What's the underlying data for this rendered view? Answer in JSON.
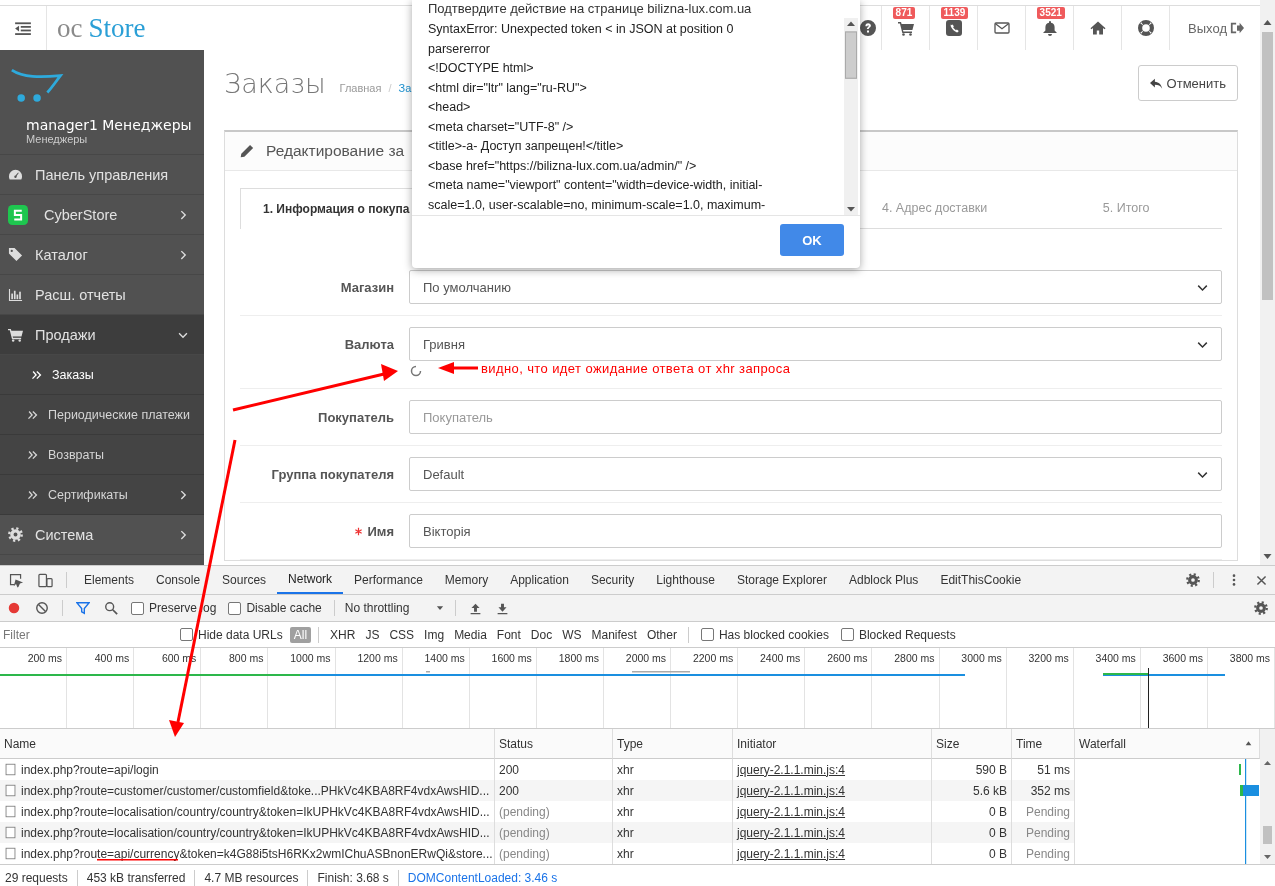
{
  "header": {
    "logo_prefix": "oc",
    "logo_name": "Store",
    "icons": [
      {
        "kind": "help"
      },
      {
        "kind": "cart",
        "badge": "871"
      },
      {
        "kind": "phone",
        "badge": "1139"
      },
      {
        "kind": "mail"
      },
      {
        "kind": "bell",
        "badge": "3521"
      },
      {
        "kind": "home"
      },
      {
        "kind": "lifebuoy"
      }
    ],
    "logout": "Выход"
  },
  "sidebar": {
    "user": "manager1 Менеджеры",
    "group": "Менеджеры",
    "items": [
      {
        "kind": "dashboard",
        "label": "Панель управления"
      },
      {
        "kind": "app",
        "label": "CyberStore",
        "expanded": false
      },
      {
        "kind": "tags",
        "label": "Каталог",
        "expanded": false
      },
      {
        "kind": "bars",
        "label": "Расш. отчеты"
      },
      {
        "kind": "cart",
        "label": "Продажи",
        "expanded": true,
        "children": [
          {
            "label": "Заказы",
            "selected": true
          },
          {
            "label": "Периодические платежи",
            "selected": false
          },
          {
            "label": "Возвраты",
            "selected": false
          },
          {
            "label": "Сертификаты",
            "selected": false,
            "expanded": false
          }
        ]
      },
      {
        "kind": "gear",
        "label": "Система",
        "expanded": false
      }
    ]
  },
  "page": {
    "title": "Заказы",
    "breadcrumb": {
      "items": [
        "Главная",
        "За"
      ],
      "separator": "/"
    },
    "cancel_button": "Отменить",
    "panel_title": "Редактирование за",
    "tabs": [
      {
        "label": "1. Информация о покупа",
        "selected": true
      },
      {
        "label": "4. Адрес доставки",
        "selected": false
      },
      {
        "label": "5. Итого",
        "selected": false
      }
    ],
    "form": [
      {
        "kind": "select",
        "label": "Магазин",
        "value": "По умолчанию"
      },
      {
        "kind": "select",
        "label": "Валюта",
        "value": "Гривня",
        "loading": true
      },
      {
        "kind": "input",
        "label": "Покупатель",
        "placeholder": "Покупатель"
      },
      {
        "kind": "select",
        "label": "Группа покупателя",
        "value": "Default"
      },
      {
        "kind": "input",
        "label": "Имя",
        "required": true,
        "value": "Вiкторiя"
      }
    ]
  },
  "dialog": {
    "title": "Подтвердите действие на странице bilizna-lux.com.ua",
    "lines": [
      "SyntaxError: Unexpected token < in JSON at position 0",
      "parsererror",
      "<!DOCTYPE html>",
      "<html dir=\"ltr\" lang=\"ru-RU\">",
      "<head>",
      "<meta charset=\"UTF-8\" />",
      "<title>-а- Доступ запрещен!</title>",
      "<base href=\"https://bilizna-lux.com.ua/admin/\" />",
      "<meta name=\"viewport\" content=\"width=device-width, initial-",
      "scale=1.0, user-scalable=no, minimum-scale=1.0, maximum-"
    ],
    "ok_button": "OK"
  },
  "annotation": {
    "note": "видно, что идет ожидание ответа от xhr запроса"
  },
  "devtools": {
    "tabs": [
      {
        "label": "Elements",
        "selected": false
      },
      {
        "label": "Console",
        "selected": false
      },
      {
        "label": "Sources",
        "selected": false
      },
      {
        "label": "Network",
        "selected": true
      },
      {
        "label": "Performance",
        "selected": false
      },
      {
        "label": "Memory",
        "selected": false
      },
      {
        "label": "Application",
        "selected": false
      },
      {
        "label": "Security",
        "selected": false
      },
      {
        "label": "Lighthouse",
        "selected": false
      },
      {
        "label": "Storage Explorer",
        "selected": false
      },
      {
        "label": "Adblock Plus",
        "selected": false
      },
      {
        "label": "EditThisCookie",
        "selected": false
      }
    ],
    "toolbar": {
      "preserve_log": {
        "label": "Preserve log",
        "checked": false
      },
      "disable_cache": {
        "label": "Disable cache",
        "checked": false
      },
      "throttling": "No throttling"
    },
    "filter": {
      "placeholder": "Filter",
      "hide_data_urls": {
        "label": "Hide data URLs",
        "checked": false
      },
      "types": [
        {
          "label": "All",
          "selected": true
        },
        {
          "label": "XHR",
          "selected": false
        },
        {
          "label": "JS",
          "selected": false
        },
        {
          "label": "CSS",
          "selected": false
        },
        {
          "label": "Img",
          "selected": false
        },
        {
          "label": "Media",
          "selected": false
        },
        {
          "label": "Font",
          "selected": false
        },
        {
          "label": "Doc",
          "selected": false
        },
        {
          "label": "WS",
          "selected": false
        },
        {
          "label": "Manifest",
          "selected": false
        },
        {
          "label": "Other",
          "selected": false
        }
      ],
      "has_blocked_cookies": {
        "label": "Has blocked cookies",
        "checked": false
      },
      "blocked_requests": {
        "label": "Blocked Requests",
        "checked": false
      }
    },
    "overview_ticks": [
      "200 ms",
      "400 ms",
      "600 ms",
      "800 ms",
      "1000 ms",
      "1200 ms",
      "1400 ms",
      "1600 ms",
      "1800 ms",
      "2000 ms",
      "2200 ms",
      "2400 ms",
      "2600 ms",
      "2800 ms",
      "3000 ms",
      "3200 ms",
      "3400 ms",
      "3600 ms",
      "3800 ms"
    ],
    "table": {
      "columns": [
        "Name",
        "Status",
        "Type",
        "Initiator",
        "Size",
        "Time",
        "Waterfall"
      ],
      "rows": [
        {
          "name": "index.php?route=api/login",
          "status": "200",
          "type": "xhr",
          "initiator": "jquery-2.1.1.min.js:4",
          "size": "590 B",
          "time": "51 ms",
          "pending": false
        },
        {
          "name": "index.php?route=customer/customer/customfield&toke...PHkVc4KBA8RF4vdxAwsHID...",
          "status": "200",
          "type": "xhr",
          "initiator": "jquery-2.1.1.min.js:4",
          "size": "5.6 kB",
          "time": "352 ms",
          "pending": false
        },
        {
          "name": "index.php?route=localisation/country/country&token=IkUPHkVc4KBA8RF4vdxAwsHID...",
          "status": "(pending)",
          "type": "xhr",
          "initiator": "jquery-2.1.1.min.js:4",
          "size": "0 B",
          "time": "Pending",
          "pending": true
        },
        {
          "name": "index.php?route=localisation/country/country&token=IkUPHkVc4KBA8RF4vdxAwsHID...",
          "status": "(pending)",
          "type": "xhr",
          "initiator": "jquery-2.1.1.min.js:4",
          "size": "0 B",
          "time": "Pending",
          "pending": true
        },
        {
          "name": "index.php?route=api/currency&token=k4G88i5tsH6RKx2wmIChuASBnonERwQi&store...",
          "status": "(pending)",
          "type": "xhr",
          "initiator": "jquery-2.1.1.min.js:4",
          "size": "0 B",
          "time": "Pending",
          "pending": true
        }
      ]
    },
    "status_bar": [
      {
        "kind": "plain",
        "text": "29 requests"
      },
      {
        "kind": "plain",
        "text": "453 kB transferred"
      },
      {
        "kind": "plain",
        "text": "4.7 MB resources"
      },
      {
        "kind": "plain",
        "text": "Finish: 3.68 s"
      },
      {
        "kind": "link",
        "text": "DOMContentLoaded: 3.46 s"
      }
    ]
  }
}
